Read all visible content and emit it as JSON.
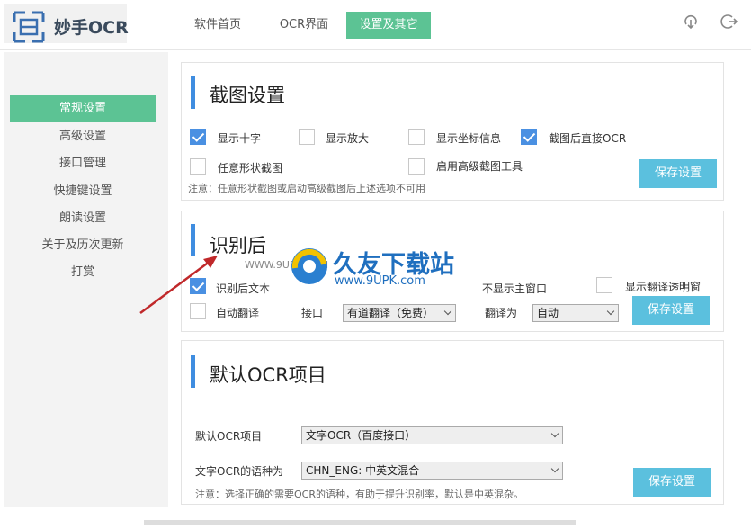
{
  "app": {
    "name": "妙手OCR"
  },
  "nav": {
    "tabs": [
      {
        "label": "软件首页",
        "active": false
      },
      {
        "label": "OCR界面",
        "active": false
      },
      {
        "label": "设置及其它",
        "active": true
      }
    ],
    "icons": [
      "download-icon",
      "logout-icon"
    ]
  },
  "sidebar": {
    "items": [
      {
        "label": "常规设置",
        "active": true
      },
      {
        "label": "高级设置",
        "active": false
      },
      {
        "label": "接口管理",
        "active": false
      },
      {
        "label": "快捷键设置",
        "active": false
      },
      {
        "label": "朗读设置",
        "active": false
      },
      {
        "label": "关于及历次更新",
        "active": false
      },
      {
        "label": "打赏",
        "active": false
      }
    ]
  },
  "screenshot_settings": {
    "title": "截图设置",
    "options": [
      {
        "label": "显示十字",
        "checked": true
      },
      {
        "label": "显示放大",
        "checked": false
      },
      {
        "label": "显示坐标信息",
        "checked": false
      },
      {
        "label": "截图后直接OCR",
        "checked": true
      },
      {
        "label": "任意形状截图",
        "checked": false
      },
      {
        "label": "启用高级截图工具",
        "checked": false
      }
    ],
    "note": "注意：任意形状截图或启动高级截图后上述选项不可用",
    "save_label": "保存设置"
  },
  "after_recognition": {
    "title": "识别后",
    "options": [
      {
        "label": "识别后文本",
        "checked": true
      },
      {
        "label": "不显示主窗口",
        "checked": false
      },
      {
        "label": "显示翻译透明窗",
        "checked": false
      },
      {
        "label": "自动翻译",
        "checked": false
      }
    ],
    "api_label": "接口",
    "api_value": "有道翻译（免费）",
    "translate_to_label": "翻译为",
    "translate_to_value": "自动",
    "save_label": "保存设置"
  },
  "default_ocr": {
    "title": "默认OCR项目",
    "project_label": "默认OCR项目",
    "project_value": "文字OCR（百度接口）",
    "language_label": "文字OCR的语种为",
    "language_value": "CHN_ENG: 中英文混合",
    "note": "注意：选择正确的需要OCR的语种，有助于提升识别率，默认是中英混杂。",
    "save_label": "保存设置"
  },
  "watermark": {
    "site_name": "久友下载站",
    "url": "www.9UPK.com",
    "overlay_url": "WWW.9UPK.COM"
  },
  "colors": {
    "accent_green": "#5cc394",
    "accent_blue": "#3f8de0",
    "button_blue": "#5bc0de",
    "arrow_red": "#c0282a"
  }
}
